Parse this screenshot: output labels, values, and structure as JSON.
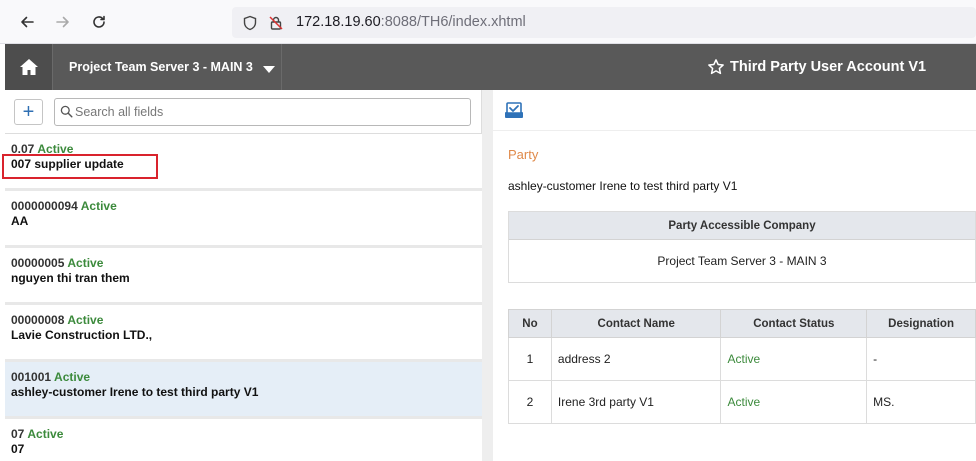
{
  "browser": {
    "url_host": "172.18.19.60",
    "url_port_path": ":8088/TH6/index.xhtml"
  },
  "header": {
    "company": "Project Team Server 3 - MAIN 3",
    "title": "Third Party User Account V1"
  },
  "search": {
    "placeholder": "Search all fields"
  },
  "add_label": "+",
  "list": [
    {
      "code": "0.07",
      "status": "Active",
      "name": "007 supplier update"
    },
    {
      "code": "0000000094",
      "status": "Active",
      "name": "AA"
    },
    {
      "code": "00000005",
      "status": "Active",
      "name": "nguyen thi tran them"
    },
    {
      "code": "00000008",
      "status": "Active",
      "name": "Lavie Construction LTD.,"
    },
    {
      "code": "001001",
      "status": "Active",
      "name": "ashley-customer Irene to test third party V1"
    },
    {
      "code": "07",
      "status": "Active",
      "name": "07"
    }
  ],
  "detail": {
    "section_title": "Party",
    "party_name": "ashley-customer Irene to test third party V1",
    "company_header": "Party Accessible Company",
    "company_value": "Project Team Server 3 - MAIN 3",
    "contact_headers": [
      "No",
      "Contact Name",
      "Contact Status",
      "Designation"
    ],
    "contacts": [
      {
        "no": "1",
        "name": "address 2",
        "status": "Active",
        "designation": "-"
      },
      {
        "no": "2",
        "name": "Irene 3rd party V1",
        "status": "Active",
        "designation": "MS."
      }
    ]
  }
}
